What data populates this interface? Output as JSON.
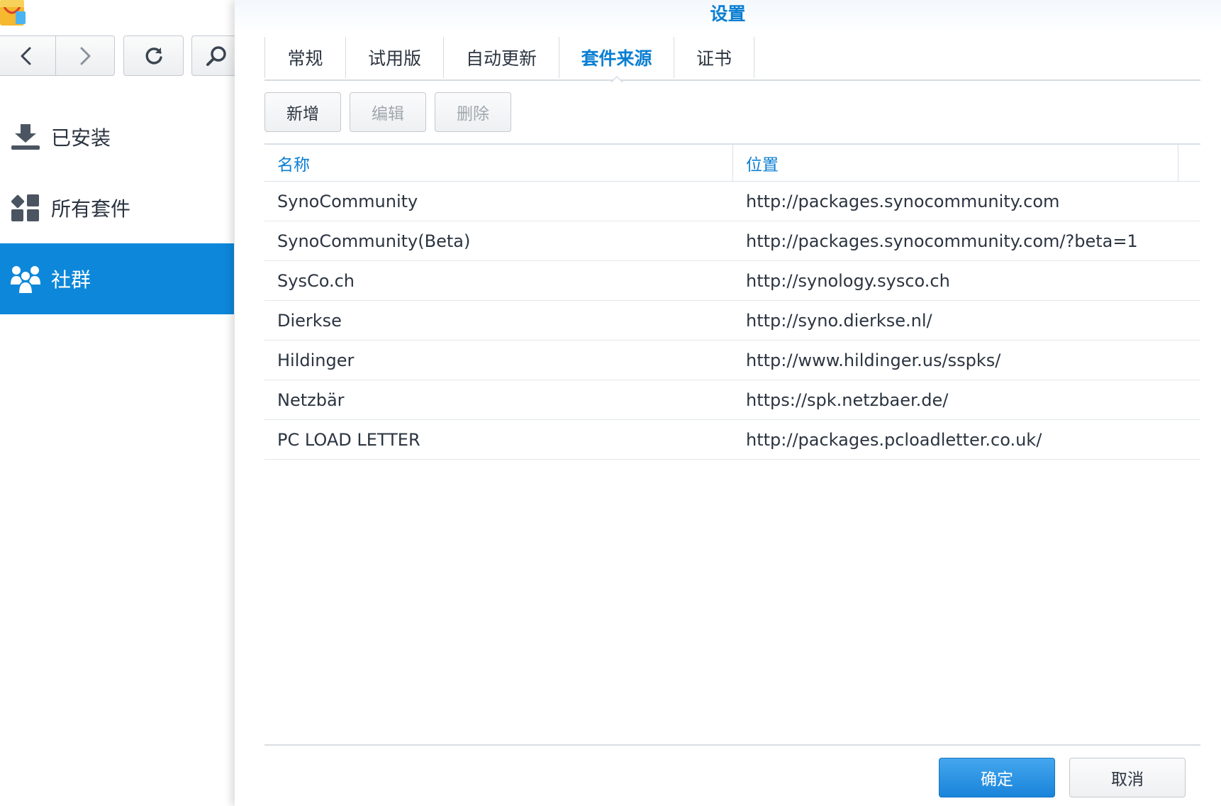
{
  "app": {
    "icon": "package-center-icon"
  },
  "toolbar": {
    "back_icon": "chevron-left-icon",
    "forward_icon": "chevron-right-icon",
    "refresh_icon": "refresh-icon",
    "search_icon": "search-icon"
  },
  "sidebar": {
    "items": [
      {
        "label": "已安装",
        "icon": "download-icon",
        "active": false
      },
      {
        "label": "所有套件",
        "icon": "grid-icon",
        "active": false
      },
      {
        "label": "社群",
        "icon": "community-icon",
        "active": true
      }
    ]
  },
  "dialog": {
    "title": "设置",
    "tabs": [
      {
        "label": "常规",
        "active": false
      },
      {
        "label": "试用版",
        "active": false
      },
      {
        "label": "自动更新",
        "active": false
      },
      {
        "label": "套件来源",
        "active": true
      },
      {
        "label": "证书",
        "active": false
      }
    ],
    "actions": {
      "add_label": "新增",
      "edit_label": "编辑",
      "delete_label": "删除"
    },
    "grid": {
      "columns": [
        "名称",
        "位置"
      ],
      "rows": [
        {
          "name": "SynoCommunity",
          "location": "http://packages.synocommunity.com"
        },
        {
          "name": "SynoCommunity(Beta)",
          "location": "http://packages.synocommunity.com/?beta=1"
        },
        {
          "name": "SysCo.ch",
          "location": "http://synology.sysco.ch"
        },
        {
          "name": "Dierkse",
          "location": "http://syno.dierkse.nl/"
        },
        {
          "name": "Hildinger",
          "location": "http://www.hildinger.us/sspks/"
        },
        {
          "name": "Netzbär",
          "location": "https://spk.netzbaer.de/"
        },
        {
          "name": "PC LOAD LETTER",
          "location": "http://packages.pcloadletter.co.uk/"
        }
      ]
    },
    "footer": {
      "ok_label": "确定",
      "cancel_label": "取消"
    }
  },
  "colors": {
    "accent": "#0b7fd3",
    "active_bg": "#0d87da"
  }
}
